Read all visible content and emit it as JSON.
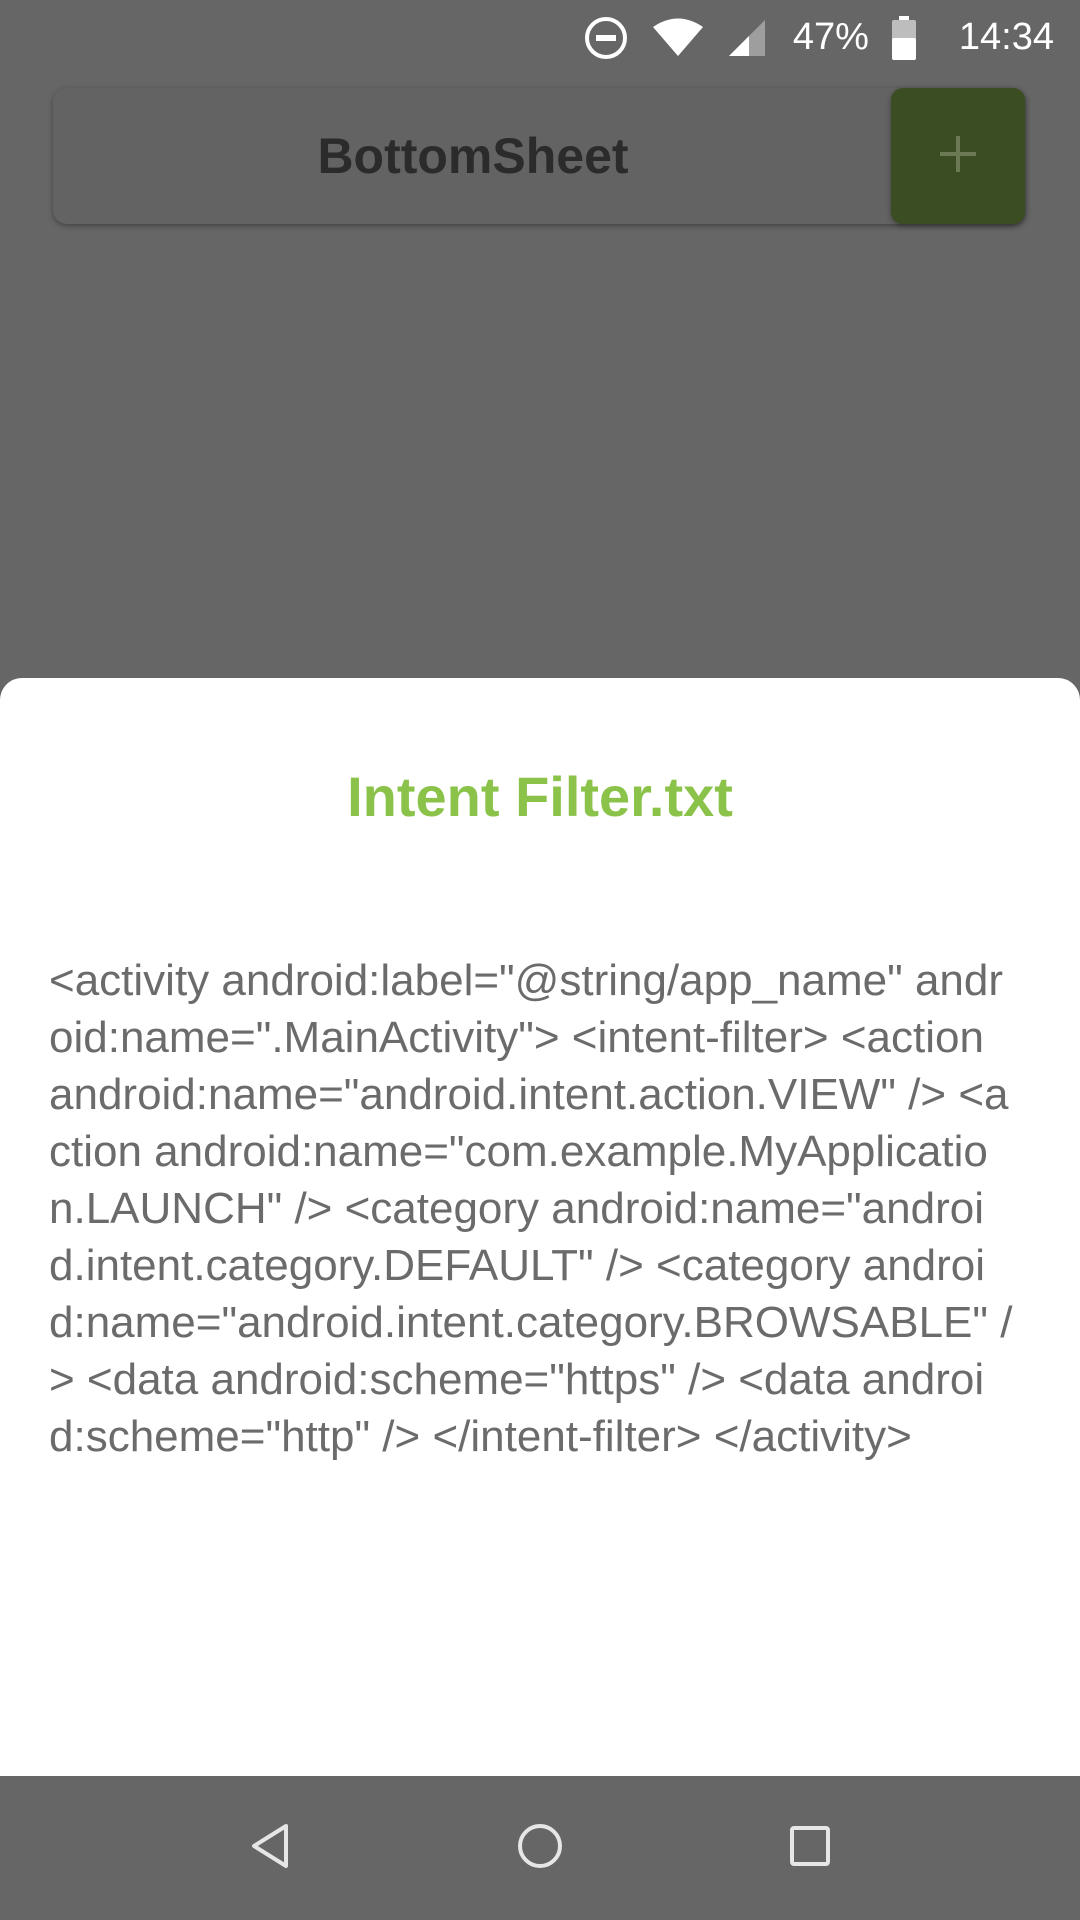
{
  "status_bar": {
    "icons": [
      "do-not-disturb-icon",
      "wifi-icon",
      "cell-signal-icon",
      "battery-icon"
    ],
    "battery_percent": "47%",
    "time": "14:34"
  },
  "app": {
    "title": "BottomSheet",
    "add_icon": "plus-icon",
    "accent_color": "#8bc34a"
  },
  "bottom_sheet": {
    "title": "Intent Filter.txt",
    "content": "<activity android:label=\"@string/app_name\" android:name=\".MainActivity\"> <intent-filter> <action android:name=\"android.intent.action.VIEW\" /> <action android:name=\"com.example.MyApplication.LAUNCH\" /> <category android:name=\"android.intent.category.DEFAULT\" /> <category android:name=\"android.intent.category.BROWSABLE\" /> <data android:scheme=\"https\" /> <data android:scheme=\"http\" /> </intent-filter> </activity>"
  },
  "nav_bar": {
    "buttons": [
      "back-icon",
      "home-icon",
      "recents-icon"
    ]
  }
}
